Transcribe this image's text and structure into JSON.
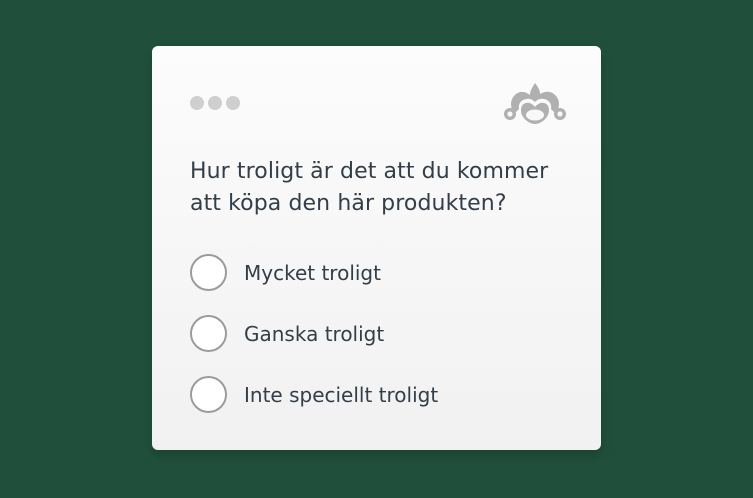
{
  "survey": {
    "question": "Hur troligt är det att du kommer att köpa den här produkten?",
    "options": [
      {
        "label": "Mycket troligt",
        "selected": false
      },
      {
        "label": "Ganska troligt",
        "selected": false
      },
      {
        "label": "Inte speciellt troligt",
        "selected": false
      }
    ]
  },
  "icons": {
    "window_controls": "three-dots-icon",
    "brand_logo": "monkey-logo-icon"
  },
  "colors": {
    "background": "#20503c",
    "card": "#f6f6f6",
    "text": "#333e48",
    "dots": "#cfcfcf",
    "logo": "#b0b0b0",
    "radio_border": "#9b9b9b"
  }
}
